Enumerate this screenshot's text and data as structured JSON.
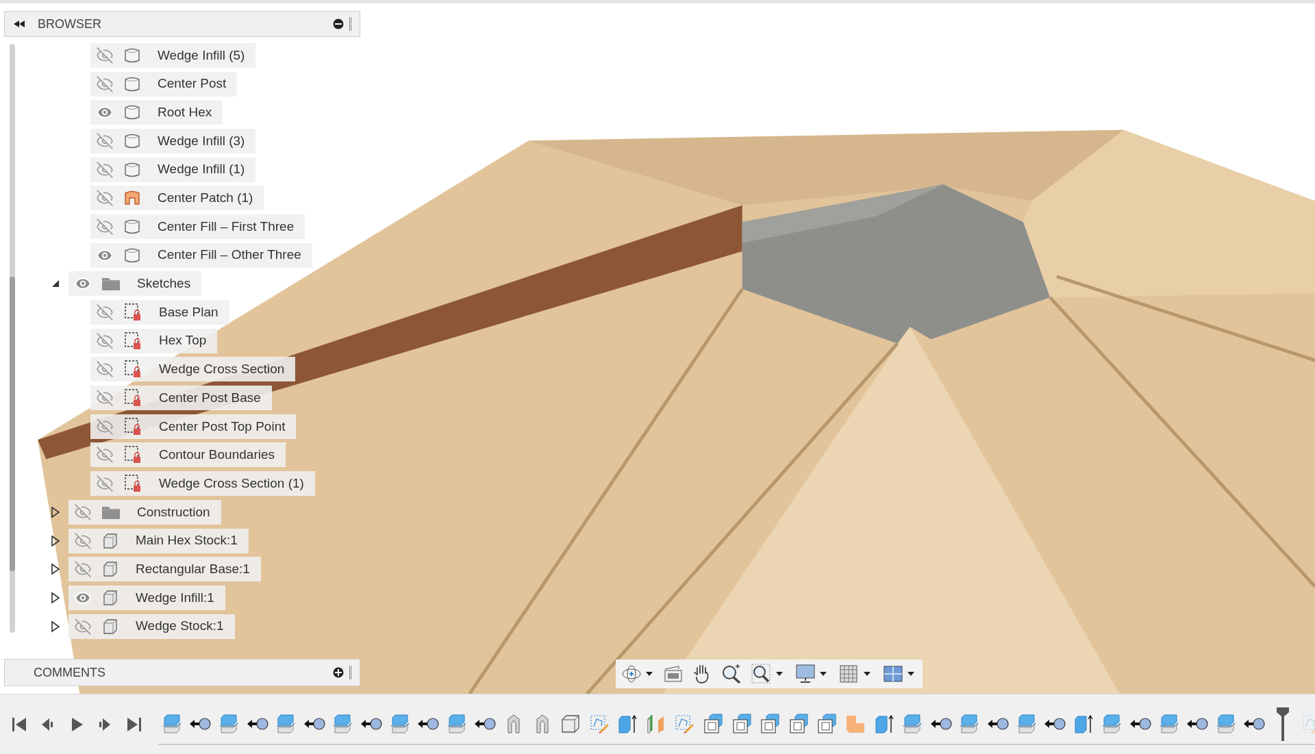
{
  "browser": {
    "title": "BROWSER"
  },
  "tree": [
    {
      "children": [
        {
          "label": "Wedge Infill (5)",
          "visible": false,
          "kind": "body"
        },
        {
          "label": "Center Post",
          "visible": false,
          "kind": "body"
        },
        {
          "label": "Root Hex",
          "visible": true,
          "kind": "body"
        },
        {
          "label": "Wedge Infill (3)",
          "visible": false,
          "kind": "body"
        },
        {
          "label": "Wedge Infill (1)",
          "visible": false,
          "kind": "body"
        },
        {
          "label": "Center Patch (1)",
          "visible": false,
          "kind": "patch"
        },
        {
          "label": "Center Fill – First Three",
          "visible": false,
          "kind": "body"
        },
        {
          "label": "Center Fill – Other Three",
          "visible": true,
          "kind": "body"
        }
      ]
    },
    {
      "label": "Sketches",
      "visible": true,
      "kind": "folder",
      "expanded": true,
      "children": [
        {
          "label": "Base Plan",
          "visible": false,
          "kind": "sketch"
        },
        {
          "label": "Hex Top",
          "visible": false,
          "kind": "sketch"
        },
        {
          "label": "Wedge Cross Section",
          "visible": false,
          "kind": "sketch"
        },
        {
          "label": "Center Post Base",
          "visible": false,
          "kind": "sketch"
        },
        {
          "label": "Center Post Top Point",
          "visible": false,
          "kind": "sketch"
        },
        {
          "label": "Contour Boundaries",
          "visible": false,
          "kind": "sketch"
        },
        {
          "label": "Wedge Cross Section (1)",
          "visible": false,
          "kind": "sketch"
        }
      ]
    },
    {
      "label": "Construction",
      "visible": false,
      "kind": "folder",
      "expanded": false
    },
    {
      "label": "Main Hex Stock:1",
      "visible": false,
      "kind": "component",
      "expanded": false
    },
    {
      "label": "Rectangular Base:1",
      "visible": false,
      "kind": "component",
      "expanded": false
    },
    {
      "label": "Wedge Infill:1",
      "visible": true,
      "kind": "component",
      "expanded": false
    },
    {
      "label": "Wedge Stock:1",
      "visible": false,
      "kind": "component",
      "expanded": false
    }
  ],
  "comments": {
    "title": "COMMENTS"
  },
  "timeline": [
    {
      "kind": "split",
      "active": true
    },
    {
      "kind": "move",
      "active": true
    },
    {
      "kind": "split",
      "active": true
    },
    {
      "kind": "move",
      "active": true
    },
    {
      "kind": "split",
      "active": true
    },
    {
      "kind": "move",
      "active": true
    },
    {
      "kind": "split",
      "active": true
    },
    {
      "kind": "move",
      "active": true
    },
    {
      "kind": "split",
      "active": true
    },
    {
      "kind": "move",
      "active": true
    },
    {
      "kind": "split",
      "active": true
    },
    {
      "kind": "move",
      "active": true
    },
    {
      "kind": "patch",
      "active": true
    },
    {
      "kind": "patch",
      "active": true
    },
    {
      "kind": "box",
      "active": true
    },
    {
      "kind": "sketch",
      "active": true
    },
    {
      "kind": "extrude",
      "active": true
    },
    {
      "kind": "splitface",
      "active": true
    },
    {
      "kind": "sketch",
      "active": true
    },
    {
      "kind": "shell",
      "active": true
    },
    {
      "kind": "shell",
      "active": true
    },
    {
      "kind": "shell",
      "active": true
    },
    {
      "kind": "shell",
      "active": true
    },
    {
      "kind": "shell",
      "active": true
    },
    {
      "kind": "boundary",
      "active": true
    },
    {
      "kind": "extrude",
      "active": true
    },
    {
      "kind": "split",
      "active": true
    },
    {
      "kind": "move",
      "active": true
    },
    {
      "kind": "split",
      "active": true
    },
    {
      "kind": "move",
      "active": true
    },
    {
      "kind": "split",
      "active": true
    },
    {
      "kind": "move",
      "active": true
    },
    {
      "kind": "extrude",
      "active": true
    },
    {
      "kind": "split",
      "active": true
    },
    {
      "kind": "move",
      "active": true
    },
    {
      "kind": "split",
      "active": true
    },
    {
      "kind": "move",
      "active": true
    },
    {
      "kind": "split",
      "active": true
    },
    {
      "kind": "move",
      "active": true
    },
    {
      "kind": "marker",
      "active": true
    },
    {
      "kind": "sketch",
      "active": false
    }
  ]
}
